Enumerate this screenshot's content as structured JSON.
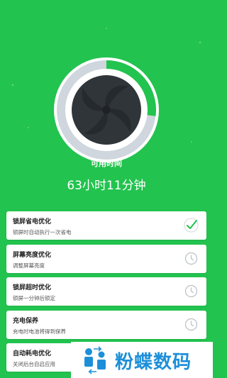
{
  "summary": {
    "label": "可用时间",
    "value": "63小时11分钟",
    "charge_level": 0.27
  },
  "items": [
    {
      "title": "锁屏省电优化",
      "desc": "锁屏时自动执行一次省电",
      "status": "done"
    },
    {
      "title": "屏幕亮度优化",
      "desc": "调整屏幕亮度",
      "status": "pending"
    },
    {
      "title": "锁屏超时优化",
      "desc": "锁屏一分钟后锁定",
      "status": "pending"
    },
    {
      "title": "充电保养",
      "desc": "充电时电池将得到保养",
      "status": "pending"
    },
    {
      "title": "自动耗电优化",
      "desc": "关闭后台自启应用",
      "status": "pending"
    }
  ],
  "watermark": {
    "brand": "粉蝶数码"
  },
  "colors": {
    "background": "#22c34e",
    "ring_track": "#cfd6dd",
    "ring_fill": "#22c34e",
    "fan": "#2f3539",
    "brand": "#1d8fd8"
  }
}
